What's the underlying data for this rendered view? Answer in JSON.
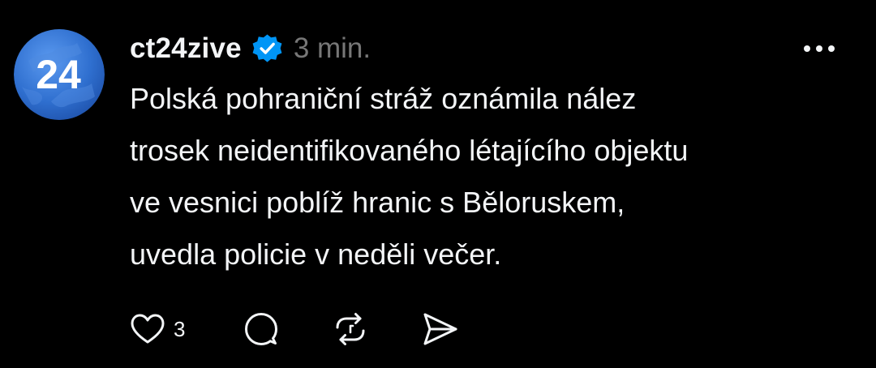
{
  "post": {
    "avatar_text": "24",
    "username": "ct24zive",
    "timestamp": "3 min.",
    "body_lines": [
      "Polská pohraniční stráž oznámila nález",
      "trosek neidentifikovaného létajícího objektu",
      "ve vesnici poblíž hranic s Běloruskem,",
      "uvedla policie v neděli večer."
    ],
    "like_count": "3"
  },
  "icons": {
    "avatar": "ct24-logo-globe",
    "verified": "verified-badge-icon",
    "more": "more-icon",
    "like": "heart-icon",
    "comment": "comment-icon",
    "repost": "repost-icon",
    "share": "send-icon"
  },
  "colors": {
    "background": "#000000",
    "text": "#f3f5f7",
    "muted": "#777777",
    "verified_blue": "#0095f6",
    "logo_blue": "#2f6fcf"
  }
}
